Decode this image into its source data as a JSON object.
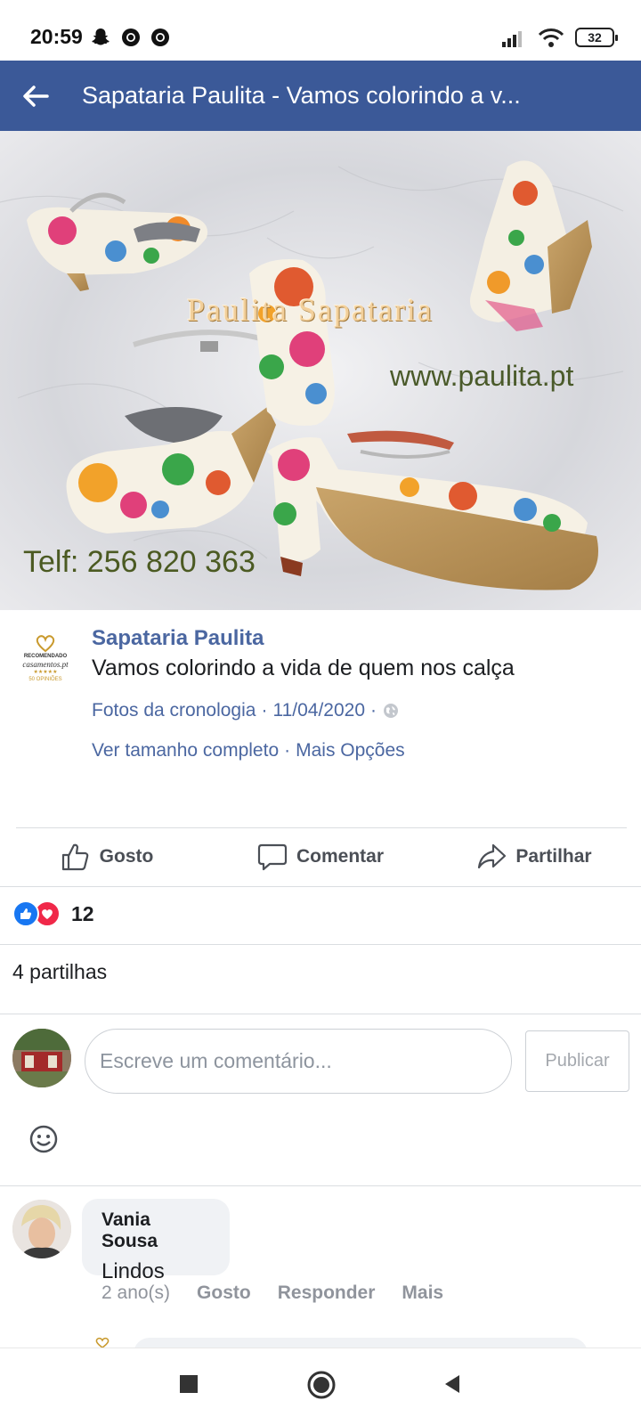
{
  "status_bar": {
    "time": "20:59",
    "battery": "32",
    "notification_icons": [
      "snapchat-icon",
      "chrome-icon",
      "chrome-icon"
    ],
    "system_icons": [
      "signal-icon",
      "wifi-icon",
      "battery-icon"
    ]
  },
  "app_bar": {
    "title": "Sapataria Paulita - Vamos colorindo a v...",
    "back_icon": "back-arrow-icon",
    "color": "#3b5998"
  },
  "photo": {
    "brand_text": "Paulita Sapataria",
    "url_text": "www.paulita.pt",
    "phone_text": "Telf: 256 820 363"
  },
  "post": {
    "avatar_badge": {
      "line1": "RECOMENDADO",
      "brand": "casamentos.pt",
      "stars": "★★★★★",
      "line2": "50 OPINIÕES"
    },
    "author": "Sapataria Paulita",
    "text": "Vamos colorindo a vida de quem nos calça",
    "album": "Fotos da cronologia",
    "separator": "·",
    "date": "11/04/2020",
    "privacy_icon": "globe-icon",
    "link_full_size": "Ver tamanho completo",
    "link_more_options": "Mais Opções"
  },
  "actions": {
    "like": "Gosto",
    "comment": "Comentar",
    "share": "Partilhar"
  },
  "reactions": {
    "count": "12",
    "types": [
      "like",
      "love"
    ]
  },
  "shares": "4 partilhas",
  "composer": {
    "placeholder": "Escreve um comentário...",
    "value": "",
    "publish": "Publicar"
  },
  "comment": {
    "name": "Vania Sousa",
    "text": "Lindos",
    "time": "2 ano(s)",
    "like": "Gosto",
    "reply": "Responder",
    "more": "Mais"
  },
  "colors": {
    "accent": "#3b5998",
    "link": "#4b67a1",
    "muted": "#90949c",
    "bubble": "#f0f2f5"
  }
}
